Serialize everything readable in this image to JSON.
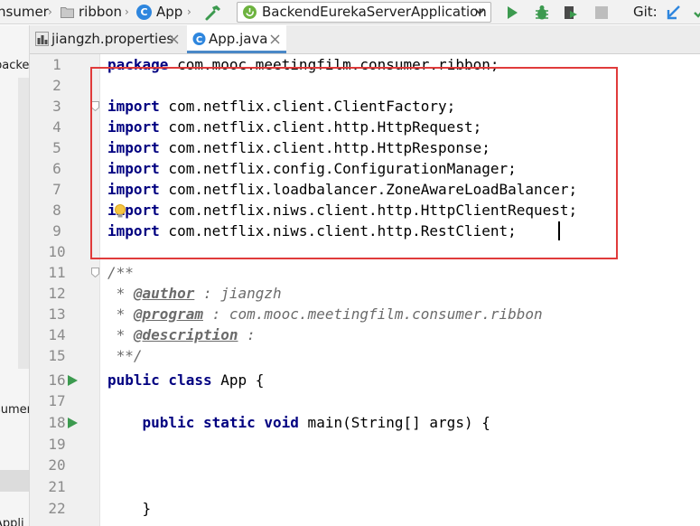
{
  "toolbar": {
    "breadcrumbs": [
      {
        "label": "nsumer"
      },
      {
        "label": "ribbon"
      },
      {
        "label": "App"
      }
    ],
    "run_config": "BackendEurekaServerApplication",
    "git_label": "Git:"
  },
  "left_panel": {
    "texts": [
      "backe",
      "sumer",
      "Appli"
    ]
  },
  "tabs": [
    {
      "label": "jiangzh.properties",
      "active": false
    },
    {
      "label": "App.java",
      "active": true
    }
  ],
  "editor": {
    "line_numbers": [
      "1",
      "2",
      "3",
      "4",
      "5",
      "6",
      "7",
      "8",
      "9",
      "10",
      "11",
      "12",
      "13",
      "14",
      "15",
      "16",
      "17",
      "18",
      "19",
      "20",
      "21",
      "22"
    ],
    "lines": {
      "l1": {
        "kw": "package",
        "rest": " com.mooc.meetingfilm.consumer.ribbon;"
      },
      "l3": {
        "kw": "import",
        "rest": " com.netflix.client.ClientFactory;"
      },
      "l4": {
        "kw": "import",
        "rest": " com.netflix.client.http.HttpRequest;"
      },
      "l5": {
        "kw": "import",
        "rest": " com.netflix.client.http.HttpResponse;"
      },
      "l6": {
        "kw": "import",
        "rest": " com.netflix.config.ConfigurationManager;"
      },
      "l7": {
        "kw": "import",
        "rest": " com.netflix.loadbalancer.ZoneAwareLoadBalancer;"
      },
      "l8": {
        "kw": "import",
        "rest": " com.netflix.niws.client.http.HttpClientRequest;"
      },
      "l9": {
        "kw": "import",
        "rest": " com.netflix.niws.client.http.RestClient;"
      },
      "l11": {
        "text": "/**"
      },
      "l12": {
        "star": " * ",
        "tag": "@author",
        "rest": " : jiangzh"
      },
      "l13": {
        "star": " * ",
        "tag": "@program",
        "rest": " : com.mooc.meetingfilm.consumer.ribbon"
      },
      "l14": {
        "star": " * ",
        "tag": "@description",
        "rest": " :"
      },
      "l15": {
        "text": " **/"
      },
      "l16": {
        "kw": "public class",
        "rest": " App {"
      },
      "l18": {
        "indent": "    ",
        "kw": "public static void",
        "rest": " main(String[] args) {"
      },
      "l22": {
        "text": "    }"
      }
    }
  },
  "colors": {
    "highlight_box": "#e03b3b",
    "keyword": "#000080",
    "comment": "#6b6b6b",
    "line_number": "#8b8b8b",
    "gutter_bg": "#f0f0f0",
    "run_green": "#3c9a4f"
  },
  "icons": [
    "folder-icon",
    "class-c-icon",
    "hammer-icon",
    "spring-boot-icon",
    "chevron-down-icon",
    "run-icon",
    "debug-icon",
    "coverage-icon",
    "stop-icon",
    "git-update-icon",
    "properties-file-icon",
    "java-file-icon",
    "close-icon",
    "run-gutter-icon",
    "fold-icon",
    "intention-bulb-icon"
  ]
}
